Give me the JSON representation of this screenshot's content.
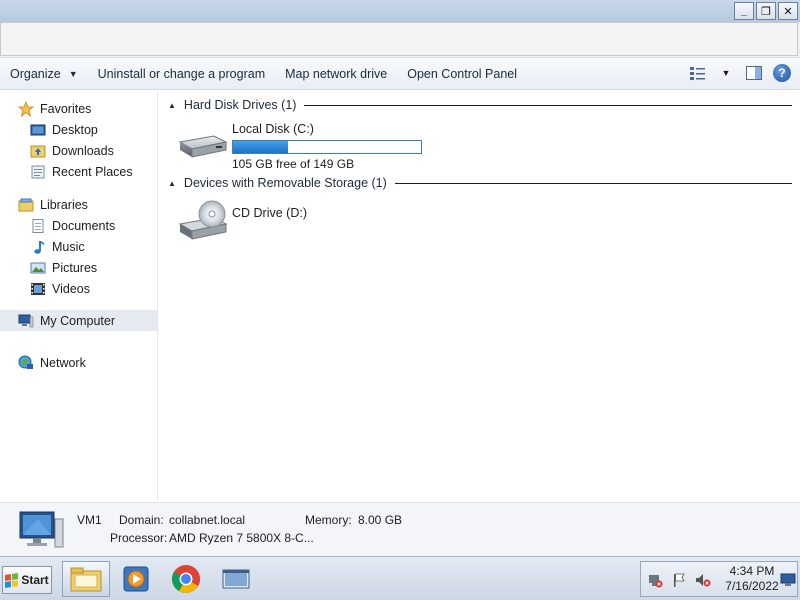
{
  "window": {
    "buttons": {
      "minimize": "_",
      "maximize": "❐",
      "close": "✕"
    }
  },
  "toolbar": {
    "organize": "Organize",
    "uninstall": "Uninstall or change a program",
    "map_drive": "Map network drive",
    "control_panel": "Open Control Panel",
    "help_label": "?"
  },
  "sidebar": {
    "favorites": {
      "label": "Favorites",
      "items": [
        "Desktop",
        "Downloads",
        "Recent Places"
      ]
    },
    "libraries": {
      "label": "Libraries",
      "items": [
        "Documents",
        "Music",
        "Pictures",
        "Videos"
      ]
    },
    "computer": {
      "label": "My Computer"
    },
    "network": {
      "label": "Network"
    }
  },
  "content": {
    "hard_disks": {
      "header": "Hard Disk Drives (1)",
      "drives": [
        {
          "name": "Local Disk (C:)",
          "free_text": "105 GB free of 149 GB",
          "used_fraction": 0.295
        }
      ]
    },
    "removable": {
      "header": "Devices with Removable Storage (1)",
      "drives": [
        {
          "name": "CD Drive (D:)"
        }
      ]
    }
  },
  "details": {
    "computer_name": "VM1",
    "domain_label": "Domain:",
    "domain_value": "collabnet.local",
    "memory_label": "Memory:",
    "memory_value": "8.00 GB",
    "processor_label": "Processor:",
    "processor_value": "AMD Ryzen 7 5800X 8-C..."
  },
  "taskbar": {
    "start_label": "Start",
    "time": "4:34 PM",
    "date": "7/16/2022"
  },
  "colors": {
    "accent": "#1c73c9",
    "selection": "#e5eaf1"
  }
}
